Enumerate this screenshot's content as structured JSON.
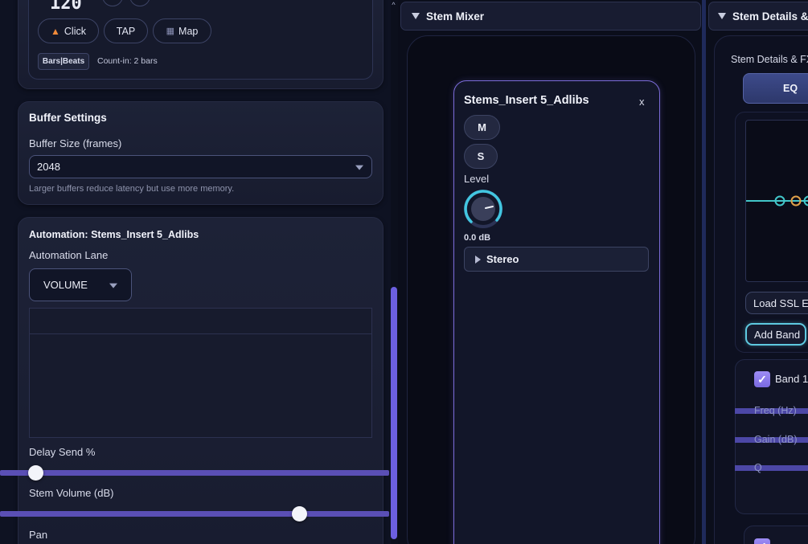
{
  "left_panel": {
    "transport": {
      "tempo": "120",
      "click_label": "Click",
      "tap_label": "TAP",
      "map_label": "Map",
      "bars_beats_label": "Bars|Beats",
      "count_in": "Count-in: 2 bars"
    },
    "buffer": {
      "title": "Buffer Settings",
      "size_label": "Buffer Size (frames)",
      "size_value": "2048",
      "hint": "Larger buffers reduce latency but use more memory."
    },
    "automation": {
      "title": "Automation: Stems_Insert 5_Adlibs",
      "lane_label": "Automation Lane",
      "lane_value": "VOLUME"
    },
    "delay_send": {
      "label": "Delay Send %",
      "value_fraction": 0.09
    },
    "stem_volume": {
      "label": "Stem Volume (dB)",
      "value_fraction": 0.77
    },
    "pan": {
      "label": "Pan"
    }
  },
  "mixer": {
    "title": "Stem Mixer",
    "strip": {
      "name": "Stems_Insert 5_Adlibs",
      "close": "x",
      "mute": "M",
      "solo": "S",
      "level_label": "Level",
      "level_value": "0.0 dB",
      "output": "Stereo"
    }
  },
  "details": {
    "title": "Stem Details & FX",
    "subtitle": "Stem Details & FX",
    "eq_tab": "EQ",
    "load_button": "Load SSL E-",
    "add_band_button": "Add Band",
    "band_label": "Band 1",
    "freq_label": "Freq (Hz)",
    "gain_label": "Gain (dB)",
    "q_label": "Q"
  },
  "colors": {
    "accent": "#6c5fe0",
    "slider": "#5a4fb5",
    "strip_border": "#7b6cd8",
    "eq_line": "#42c6c9",
    "eq_node_orange": "#e0a04a"
  }
}
